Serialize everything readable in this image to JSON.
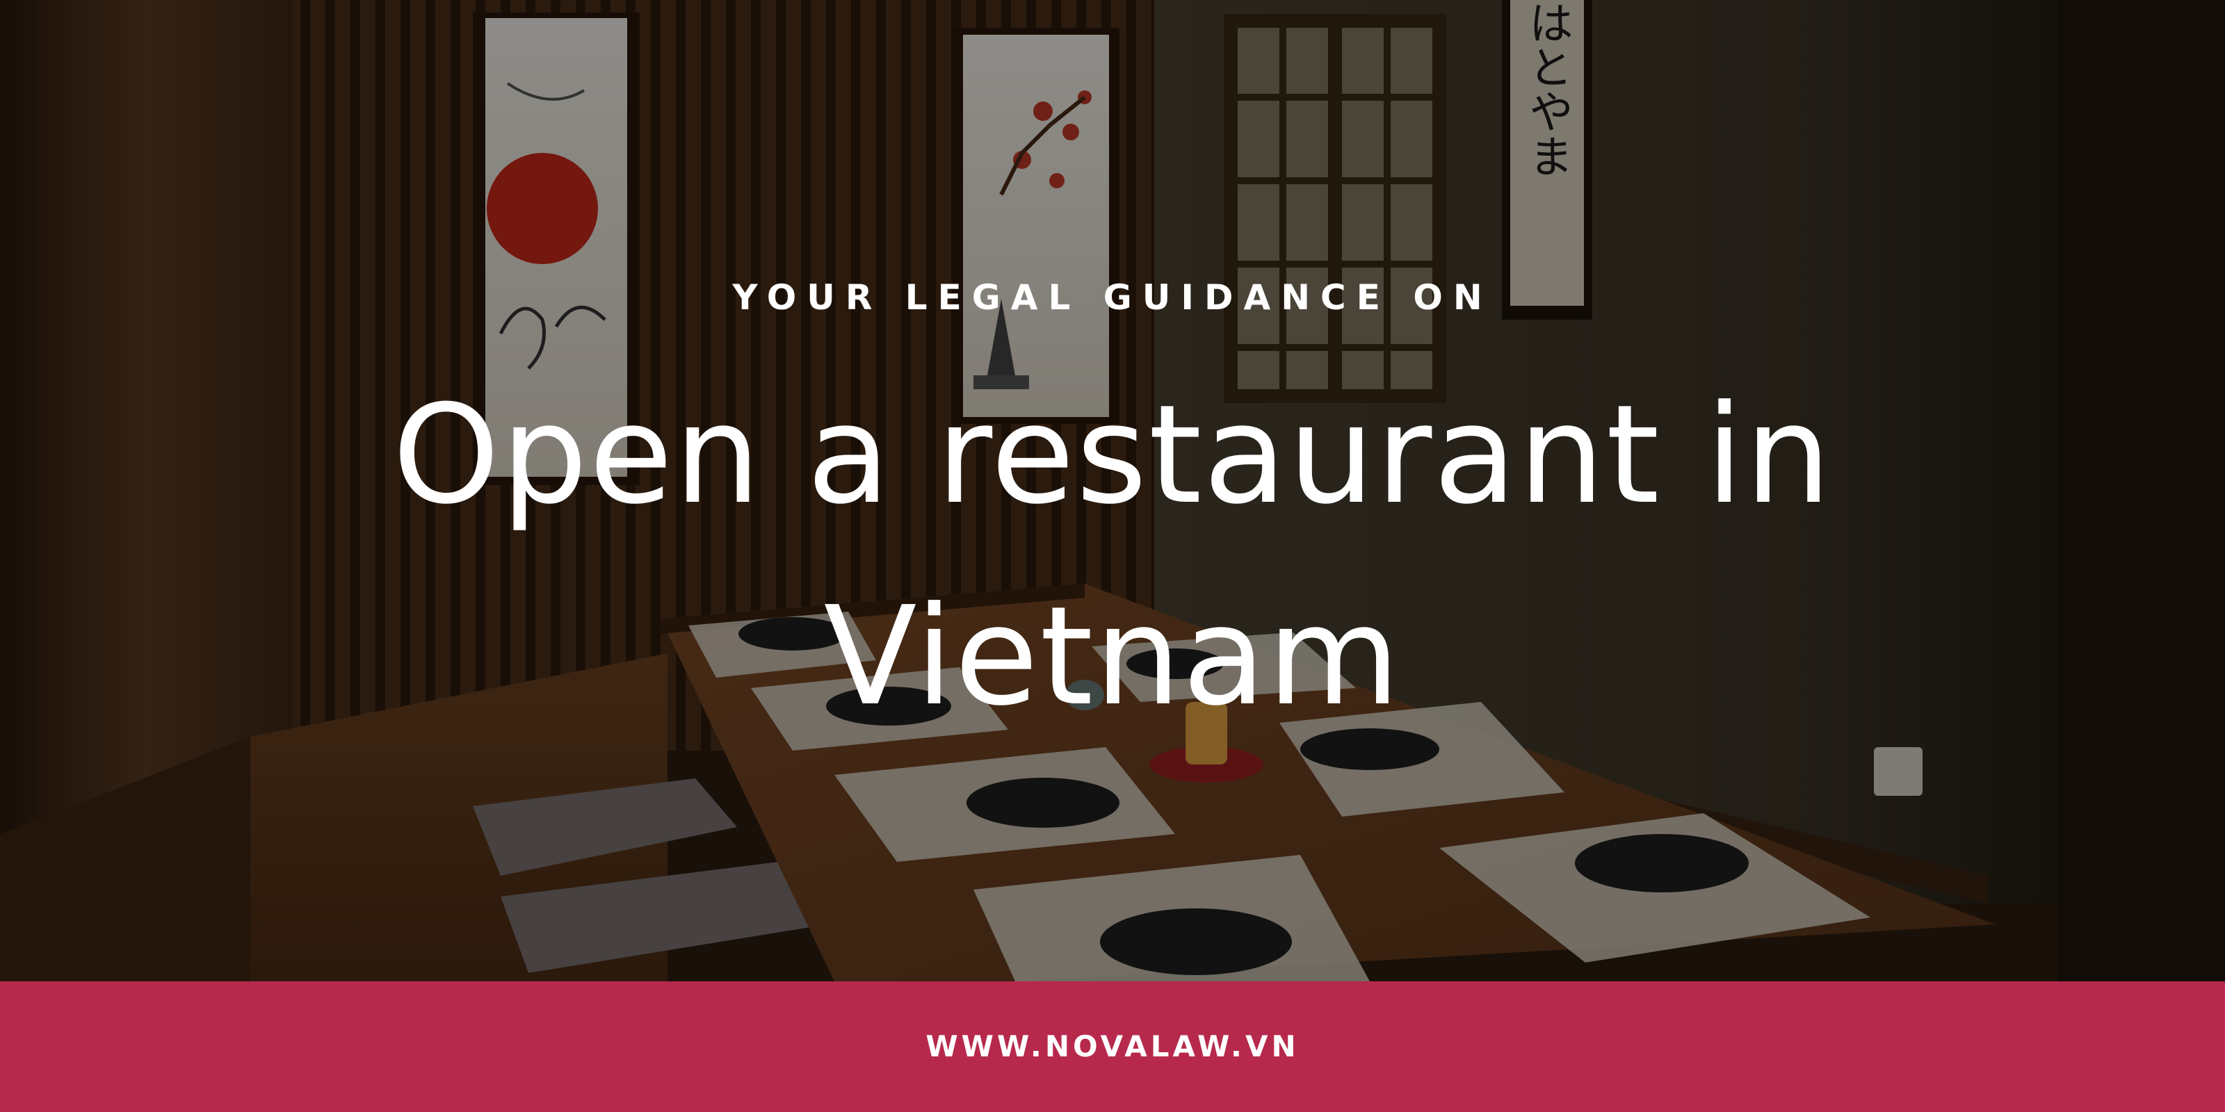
{
  "hero": {
    "eyebrow": "YOUR LEGAL GUIDANCE ON",
    "title_line1": "Open a restaurant in",
    "title_line2": "Vietnam",
    "overlay_color": "#000000",
    "text_color": "#ffffff"
  },
  "artwork": {
    "scroll_text": "はとやま"
  },
  "footer": {
    "url": "WWW.NOVALAW.VN",
    "background_color": "#b7294c"
  }
}
